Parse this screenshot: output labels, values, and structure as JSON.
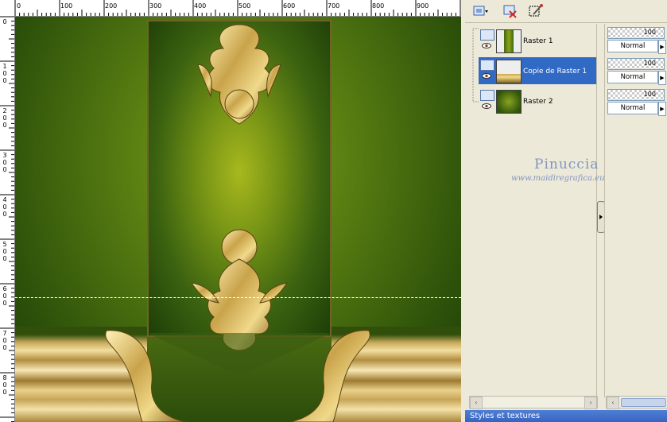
{
  "ruler": {
    "top_labels": [
      "0",
      "100",
      "200",
      "300",
      "400",
      "500",
      "600",
      "700",
      "800",
      "900"
    ],
    "left_labels": [
      "0",
      "100",
      "200",
      "300",
      "400",
      "500",
      "600",
      "700",
      "800"
    ]
  },
  "toolbar": {
    "icons": [
      "new-layer-icon",
      "delete-layer-icon",
      "mask-icon"
    ]
  },
  "layers": [
    {
      "name": "Raster 1",
      "selected": false
    },
    {
      "name": "Copie de Raster 1",
      "selected": true
    },
    {
      "name": "Raster 2",
      "selected": false
    }
  ],
  "props": [
    {
      "opacity": "100",
      "blend": "Normal"
    },
    {
      "opacity": "100",
      "blend": "Normal"
    },
    {
      "opacity": "100",
      "blend": "Normal"
    }
  ],
  "watermark": {
    "name": "Pinuccia",
    "url": "www.maidiregrafica.eu"
  },
  "palette_title": "Styles et textures",
  "colors": {
    "selected_row": "#316ac5",
    "panel_bg": "#ece9d8",
    "title_bar": "#3864c0"
  }
}
